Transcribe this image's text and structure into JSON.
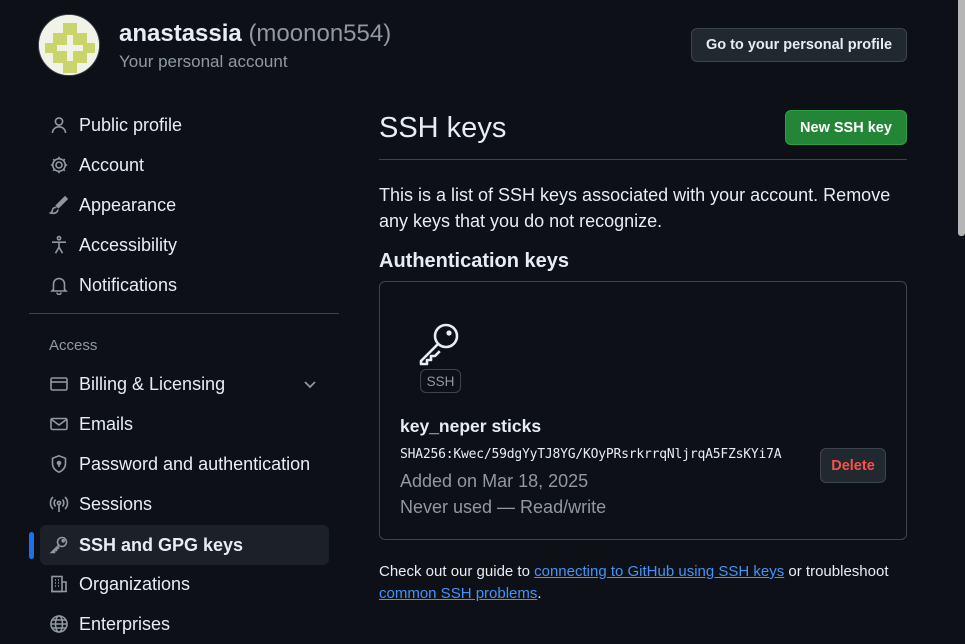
{
  "header": {
    "user_name": "anastassia",
    "user_login": "(moonon554)",
    "subtitle": "Your personal account",
    "profile_button": "Go to your personal profile"
  },
  "sidebar": {
    "items_top": [
      {
        "label": "Public profile",
        "icon": "person-icon"
      },
      {
        "label": "Account",
        "icon": "gear-icon"
      },
      {
        "label": "Appearance",
        "icon": "paintbrush-icon"
      },
      {
        "label": "Accessibility",
        "icon": "accessibility-icon"
      },
      {
        "label": "Notifications",
        "icon": "bell-icon"
      }
    ],
    "section_label": "Access",
    "items_access": [
      {
        "label": "Billing & Licensing",
        "icon": "credit-card-icon"
      },
      {
        "label": "Emails",
        "icon": "mail-icon"
      },
      {
        "label": "Password and authentication",
        "icon": "shield-lock-icon"
      },
      {
        "label": "Sessions",
        "icon": "broadcast-icon"
      },
      {
        "label": "SSH and GPG keys",
        "icon": "key-icon"
      },
      {
        "label": "Organizations",
        "icon": "organization-icon"
      },
      {
        "label": "Enterprises",
        "icon": "globe-icon"
      }
    ]
  },
  "main": {
    "title": "SSH keys",
    "new_button": "New SSH key",
    "description": "This is a list of SSH keys associated with your account. Remove any keys that you do not recognize.",
    "section_title": "Authentication keys",
    "key": {
      "badge": "SSH",
      "title": "key_neper sticks",
      "fingerprint": "SHA256:Kwec/59dgYyTJ8YG/KOyPRsrkrrqNljrqA5FZsKYi7A",
      "added": "Added on Mar 18, 2025",
      "usage": "Never used — Read/write",
      "delete_label": "Delete"
    },
    "guide": {
      "prefix": "Check out our guide to ",
      "link1": "connecting to GitHub using SSH keys",
      "middle": " or troubleshoot ",
      "link2": "common SSH problems",
      "suffix": "."
    }
  },
  "colors": {
    "background": "#0d1117",
    "accent_blue": "#1f6feb",
    "link": "#4493f8",
    "success": "#238636",
    "danger": "#f85149"
  }
}
